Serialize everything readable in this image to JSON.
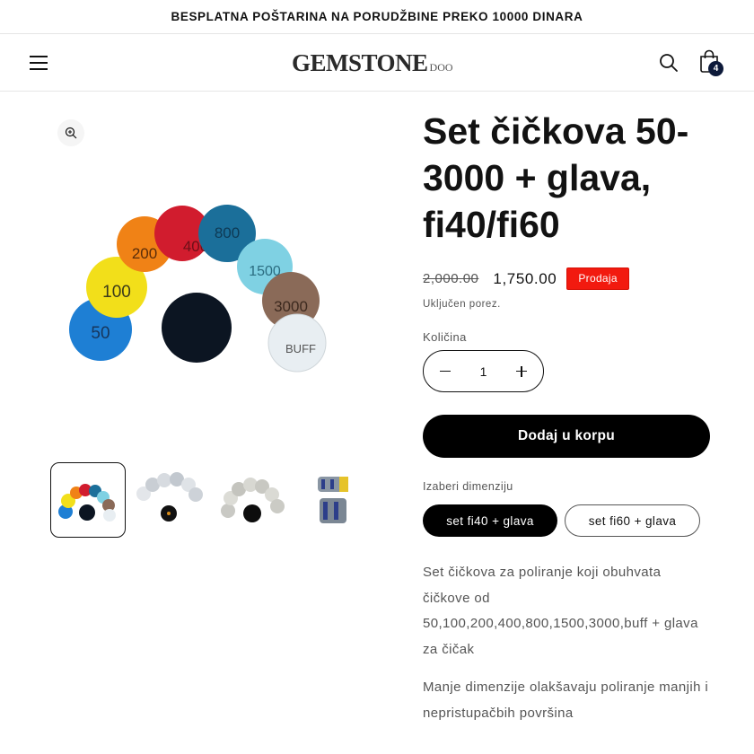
{
  "announcement": {
    "text": "BESPLATNA POŠTARINA NA PORUDŽBINE PREKO 10000 DINARA"
  },
  "header": {
    "logo_main": "GEMSTONE",
    "logo_suffix": "DOO",
    "cart_count": "4",
    "icons": {
      "menu": "hamburger-menu-icon",
      "search": "search-icon",
      "cart": "shopping-bag-icon"
    }
  },
  "product": {
    "title": "Set čičkova 50-3000 + glava, fi40/fi60",
    "old_price": "2,000.00",
    "price": "1,750.00",
    "sale_badge": "Prodaja",
    "tax_note": "Uključen porez.",
    "quantity_label": "Količina",
    "quantity": "1",
    "add_to_cart": "Dodaj u korpu",
    "variant_label": "Izaberi dimenziju",
    "variants": [
      "set fi40 + glava",
      "set fi60 + glava"
    ],
    "selected_variant": "set fi40 + glava",
    "description": [
      "Set čičkova za poliranje koji obuhvata čičkove od 50,100,200,400,800,1500,3000,buff + glava za čičak",
      "Manje dimenzije olakšavaju poliranje manjih i nepristupačbih površina"
    ]
  },
  "gallery": {
    "disc_labels": [
      "50",
      "100",
      "200",
      "400",
      "800",
      "1500",
      "3000",
      "BUFF"
    ],
    "thumbnail_count": 4,
    "active_thumbnail": 1
  },
  "colors": {
    "sale_badge": "#f21a0f",
    "button_bg": "#000000",
    "cart_badge": "#0d1a3a",
    "text_muted": "#555555"
  }
}
